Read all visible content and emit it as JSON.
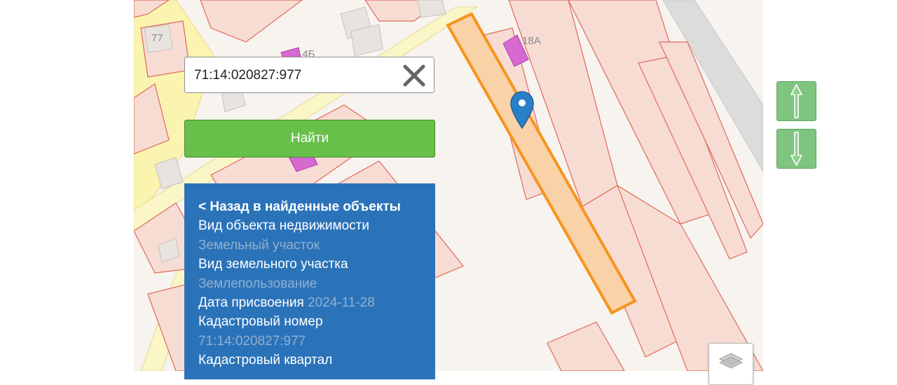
{
  "search": {
    "value": "71:14:020827:977",
    "find_label": "Найти"
  },
  "map": {
    "labels": [
      "77",
      "14Б",
      "18А"
    ]
  },
  "info": {
    "back_label": "< Назад в найденные объекты",
    "object_type_label": "Вид объекта недвижимости",
    "object_type_value": "Земельный участок",
    "land_type_label": "Вид земельного участка",
    "land_type_value": "Землепользование",
    "date_label": "Дата присвоения",
    "date_value": "2024-11-28",
    "cadastral_number_label": "Кадастровый номер",
    "cadastral_number_value": "71:14:020827:977",
    "cadastral_quarter_label": "Кадастровый квартал"
  },
  "colors": {
    "accent_green": "#67c04a",
    "panel_blue": "#2b73b9",
    "parcel_highlight": "#f7941d",
    "marker_blue": "#2a7fc9"
  },
  "icons": {
    "clear": "close-icon",
    "up": "arrow-up-icon",
    "down": "arrow-down-icon",
    "layers": "layers-icon",
    "marker": "map-marker-icon"
  }
}
